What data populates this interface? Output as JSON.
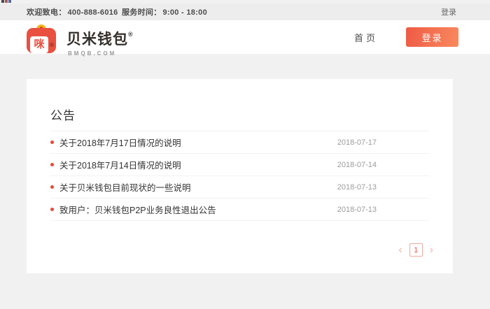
{
  "topbar": {
    "welcome_label": "欢迎致电：",
    "phone": "400-888-6016",
    "service_label": "服务时间：",
    "service_hours": "9:00 - 18:00",
    "login_link": "登录"
  },
  "brand": {
    "name": "贝米钱包",
    "registered_mark": "®",
    "domain": "BMQB.COM",
    "logo_glyph": "咪",
    "logo_color": "#e9503f",
    "clasp_color": "#f3b51c"
  },
  "nav": {
    "home_label": "首页",
    "login_button_label": "登录",
    "login_button_gradient": [
      "#ee5a45",
      "#f98a5e"
    ]
  },
  "announcements": {
    "heading": "公告",
    "bullet_color": "#e8493a",
    "items": [
      {
        "title": "关于2018年7月17日情况的说明",
        "date": "2018-07-17"
      },
      {
        "title": "关于2018年7月14日情况的说明",
        "date": "2018-07-14"
      },
      {
        "title": "关于贝米钱包目前现状的一些说明",
        "date": "2018-07-13"
      },
      {
        "title": "致用户：贝米钱包P2P业务良性退出公告",
        "date": "2018-07-13"
      }
    ]
  },
  "pagination": {
    "prev_icon": "‹",
    "next_icon": "›",
    "current_page": "1",
    "accent_color": "#e8584a"
  }
}
